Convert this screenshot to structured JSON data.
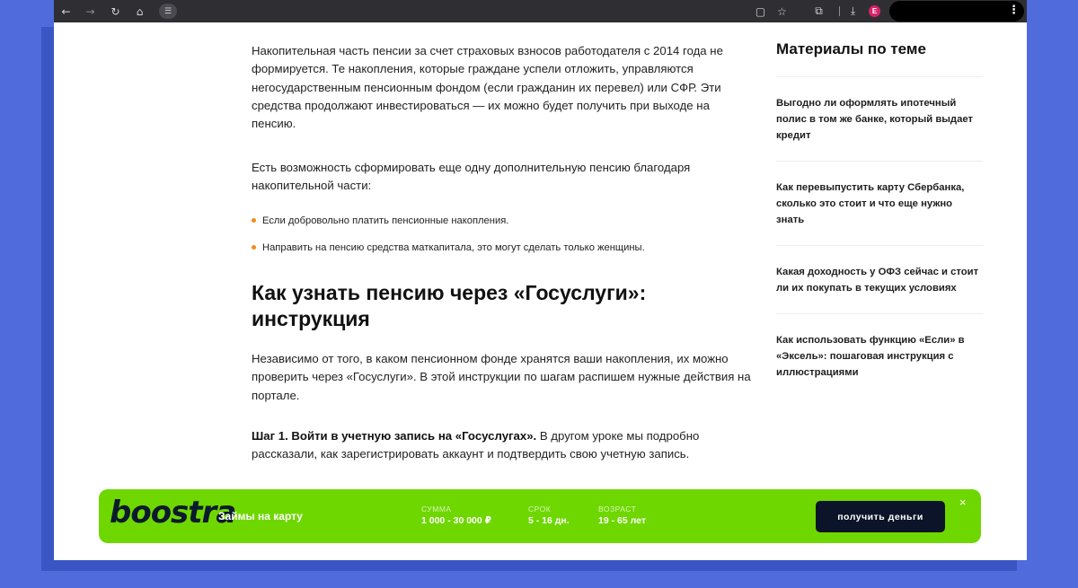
{
  "browser": {
    "nav_back_icon": "arrow-left-icon",
    "nav_forward_icon": "arrow-right-icon",
    "reload_icon": "reload-icon",
    "home_icon": "home-icon",
    "site_settings_icon": "tune-icon",
    "profile_initial": "E"
  },
  "article": {
    "p1": "Накопительная часть пенсии за счет страховых взносов работодателя с 2014 года не формируется. Те накопления, которые граждане успели отложить, управляются негосударственным пенсионным фондом (если гражданин их перевел) или СФР. Эти средства продолжают инвестироваться — их можно будет получить при выходе на пенсию.",
    "p2": "Есть возможность сформировать еще одну дополнительную пенсию благодаря накопительной части:",
    "list": [
      "Если добровольно платить пенсионные накопления.",
      "Направить на пенсию средства маткапитала, это могут сделать только женщины."
    ],
    "heading": "Как узнать пенсию через «Госуслуги»: инструкция",
    "p3": "Независимо от того, в каком пенсионном фонде хранятся ваши накопления, их можно проверить через «Госуслуги». В этой инструкции по шагам распишем нужные действия на портале.",
    "p4_bold": "Шаг 1. Войти в учетную запись на «Госуслугах».",
    "p4_rest": " В другом уроке мы подробно рассказали, как зарегистрировать аккаунт и подтвердить свою учетную запись."
  },
  "aside": {
    "title": "Материалы по теме",
    "items": [
      "Выгодно ли оформлять ипотечный полис в том же банке, который выдает кредит",
      "Как перевыпустить карту Сбербанка, сколько это стоит и что еще нужно знать",
      "Какая доходность у ОФЗ сейчас и стоит ли их покупать в текущих условиях",
      "Как использовать функцию «Если» в «Эксель»: пошаговая инструкция с иллюстрациями"
    ]
  },
  "banner": {
    "logo": "boostra",
    "tagline": "Займы на карту",
    "sum_label": "СУММА",
    "sum_value": "1 000 - 30 000 ₽",
    "term_label": "СРОК",
    "term_value": "5 - 16 дн.",
    "age_label": "ВОЗРАСТ",
    "age_value": "19 - 65 лет",
    "button": "получить деньги",
    "close": "×",
    "colors": {
      "background": "#6ed700",
      "button": "#0b1428"
    }
  }
}
